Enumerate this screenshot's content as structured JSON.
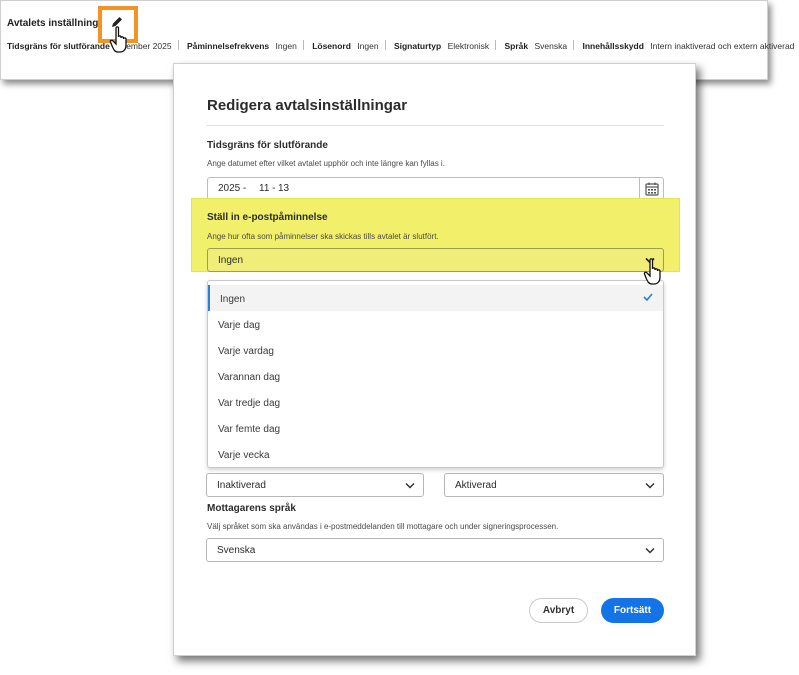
{
  "settings_bar": {
    "title": "Avtalets inställningar",
    "fields": [
      {
        "label": "Tidsgräns för slutförande",
        "value": "ember 2025"
      },
      {
        "label": "Påminnelsefrekvens",
        "value": "Ingen"
      },
      {
        "label": "Lösenord",
        "value": "Ingen"
      },
      {
        "label": "Signaturtyp",
        "value": "Elektronisk"
      },
      {
        "label": "Språk",
        "value": "Svenska"
      },
      {
        "label": "Innehållsskydd",
        "value": "Intern inaktiverad och extern aktiverad"
      }
    ],
    "edit_icon": "pencil-icon"
  },
  "dialog": {
    "title": "Redigera avtalsinställningar",
    "deadline": {
      "label": "Tidsgräns för slutförande",
      "help": "Ange datumet efter vilket avtalet upphör och inte längre kan fyllas i.",
      "year": "2025 -",
      "month": "11 -",
      "day": "13",
      "icon": "calendar-icon"
    },
    "reminder": {
      "label": "Ställ in e-postpåminnelse",
      "help": "Ange hur ofta som påminnelser ska skickas tills avtalet är slutfört.",
      "selected": "Ingen",
      "options": [
        "Ingen",
        "Varje dag",
        "Varje vardag",
        "Varannan dag",
        "Var tredje dag",
        "Var femte dag",
        "Varje vecka"
      ],
      "highlight_color": "#f2f06a"
    },
    "protection": {
      "internal_value": "Inaktiverad",
      "external_value": "Aktiverad"
    },
    "language": {
      "label": "Mottagarens språk",
      "help": "Välj språket som ska användas i e-postmeddelanden till mottagare och under signeringsprocessen.",
      "selected": "Svenska"
    },
    "buttons": {
      "cancel": "Avbryt",
      "continue": "Fortsätt",
      "primary_color": "#1473e6"
    }
  }
}
